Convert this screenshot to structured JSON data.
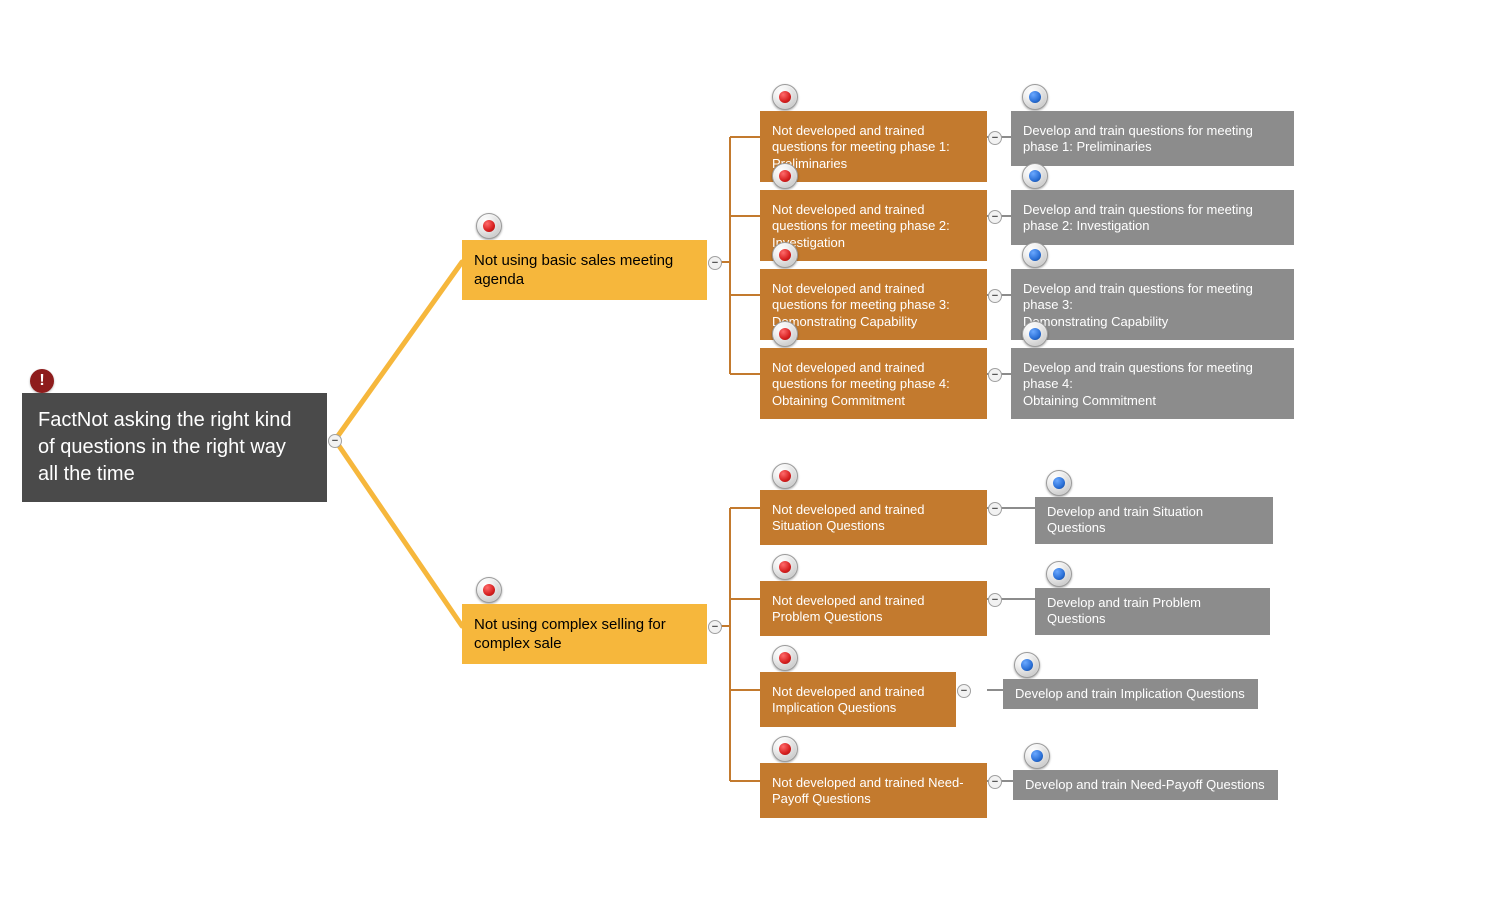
{
  "root": {
    "label": "FactNot asking the right kind of questions in the right way\nall the time"
  },
  "branches": {
    "b1": {
      "label": "Not using basic sales meeting agenda",
      "children": [
        {
          "problem": "Not developed and trained questions for meeting phase 1: Preliminaries",
          "action": "Develop and train questions for meeting phase 1: Preliminaries"
        },
        {
          "problem": "Not developed and trained questions for meeting phase 2: Investigation",
          "action": "Develop and train questions for meeting phase 2: Investigation"
        },
        {
          "problem": "Not developed and trained questions for meeting phase 3: Demonstrating Capability",
          "action": "Develop and train questions for meeting phase 3:\nDemonstrating Capability"
        },
        {
          "problem": "Not developed and trained questions for meeting phase 4: Obtaining Commitment",
          "action": "Develop and train questions for meeting phase 4:\nObtaining Commitment"
        }
      ]
    },
    "b2": {
      "label": "Not using complex selling for complex sale",
      "children": [
        {
          "problem": "Not developed and trained Situation Questions",
          "action": "Develop and train Situation Questions"
        },
        {
          "problem": "Not developed and trained Problem Questions",
          "action": "Develop and train Problem Questions"
        },
        {
          "problem": "Not developed and trained Implication Questions",
          "action": "Develop and train Implication Questions"
        },
        {
          "problem": "Not developed and trained Need-Payoff Questions",
          "action": "Develop and train Need-Payoff Questions"
        }
      ]
    }
  },
  "colors": {
    "root": "#4a4a4a",
    "level2": "#f6b73c",
    "level3": "#c37a2e",
    "level4": "#8c8c8c",
    "line_root": "#f6b73c",
    "line_branch": "#c37a2e",
    "line_leaf": "#8c8c8c",
    "badge_red": "#d61f1f",
    "badge_blue": "#2a6fd6"
  }
}
